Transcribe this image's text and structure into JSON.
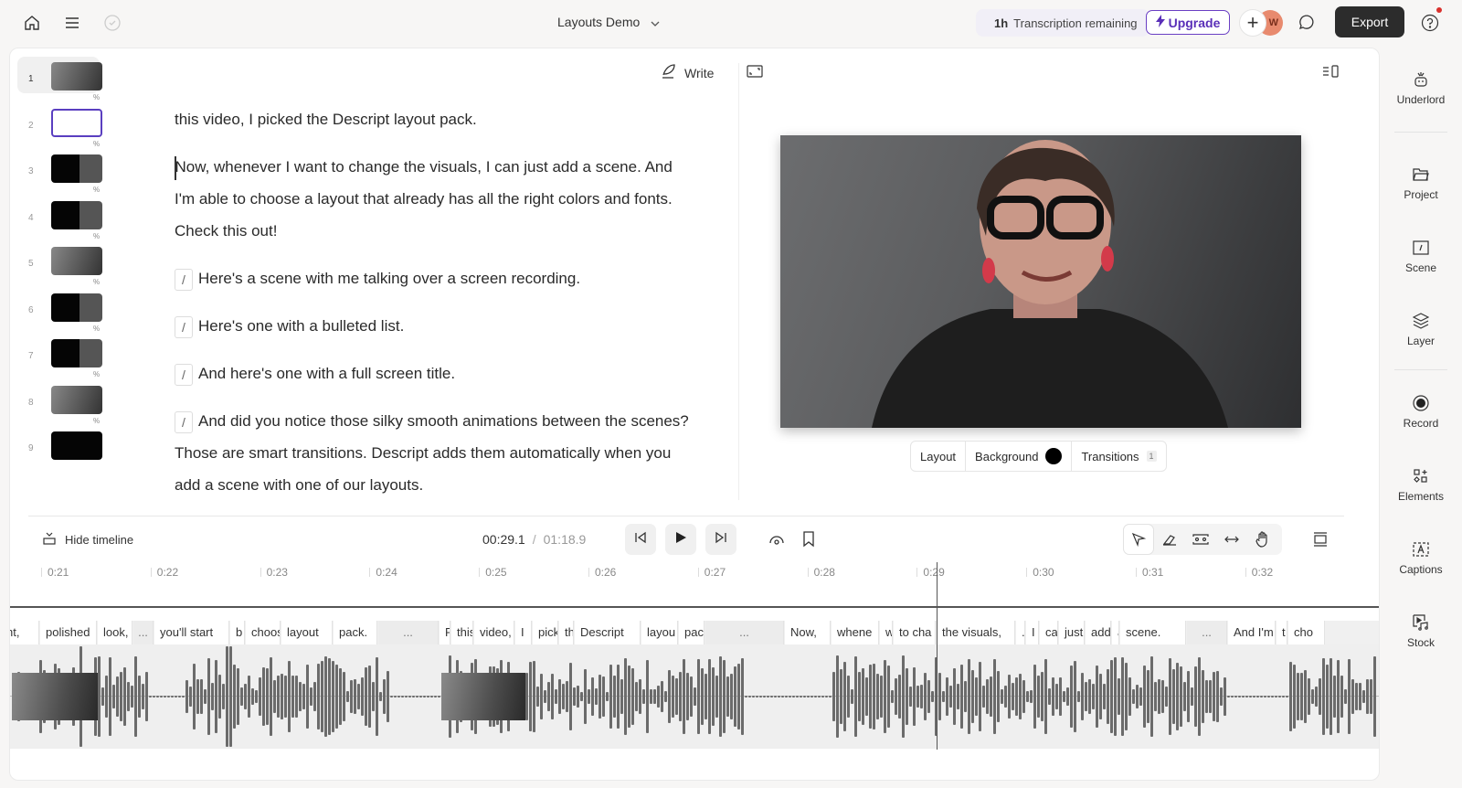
{
  "topbar": {
    "project_title": "Layouts Demo",
    "transcription_amount": "1h",
    "transcription_label": "Transcription remaining",
    "upgrade_label": "Upgrade",
    "avatar_initial": "W",
    "export_label": "Export",
    "icons": [
      "home-icon",
      "menu-icon",
      "check-circle-icon",
      "chevron-down-icon",
      "lightning-icon",
      "plus-icon",
      "comment-icon",
      "help-icon"
    ]
  },
  "scenes": [
    {
      "number": "1",
      "selected": true
    },
    {
      "number": "2",
      "selected": false
    },
    {
      "number": "3",
      "selected": false
    },
    {
      "number": "4",
      "selected": false
    },
    {
      "number": "5",
      "selected": false
    },
    {
      "number": "6",
      "selected": false
    },
    {
      "number": "7",
      "selected": false
    },
    {
      "number": "8",
      "selected": false
    },
    {
      "number": "9",
      "selected": false
    }
  ],
  "script": {
    "write_label": "Write",
    "paragraphs": [
      "this video, I picked the Descript layout pack.",
      "Now, whenever I want to change the visuals, I can just add a scene. And I'm able to choose a layout that already has all the right colors and fonts. Check this out!",
      "Here's a scene with me talking over a screen recording.",
      "Here's one with a bulleted list.",
      "And here's one with a full screen title.",
      "And did you notice those silky smooth animations between the scenes? Those are smart transitions. Descript adds them automatically when you add a scene with one of our layouts."
    ],
    "scene_marker": "/"
  },
  "preview": {
    "tabs": {
      "layout": "Layout",
      "background": "Background",
      "transitions": "Transitions",
      "transitions_count": "1"
    },
    "background_color": "#000000"
  },
  "timeline": {
    "hide_label": "Hide timeline",
    "current_time": "00:29.1",
    "separator": "/",
    "total_time": "01:18.9",
    "ruler": [
      "0:21",
      "0:22",
      "0:23",
      "0:24",
      "0:25",
      "0:26",
      "0:27",
      "0:28",
      "0:29",
      "0:30",
      "0:31",
      "0:32"
    ],
    "words": [
      "nt,",
      "polished",
      "look,",
      "...",
      "you'll start",
      "b",
      "choos",
      "layout",
      "pack.",
      "...",
      "F",
      "this",
      "video,",
      "I",
      "pick",
      "th",
      "Descript",
      "layou",
      "pack",
      "...",
      "Now,",
      "whene",
      "w",
      "to cha",
      "the visuals,",
      ".",
      "I",
      "ca",
      "just",
      "add",
      "a",
      "scene.",
      "...",
      "And I'm",
      "t",
      "cho"
    ]
  },
  "sidebar": {
    "items": [
      {
        "label": "Underlord",
        "icon": "robot-icon"
      },
      {
        "label": "Project",
        "icon": "folder-icon"
      },
      {
        "label": "Scene",
        "icon": "scene-icon"
      },
      {
        "label": "Layer",
        "icon": "layers-icon"
      },
      {
        "label": "Record",
        "icon": "record-icon"
      },
      {
        "label": "Elements",
        "icon": "elements-icon"
      },
      {
        "label": "Captions",
        "icon": "captions-icon"
      },
      {
        "label": "Stock",
        "icon": "stock-media-icon"
      }
    ]
  }
}
